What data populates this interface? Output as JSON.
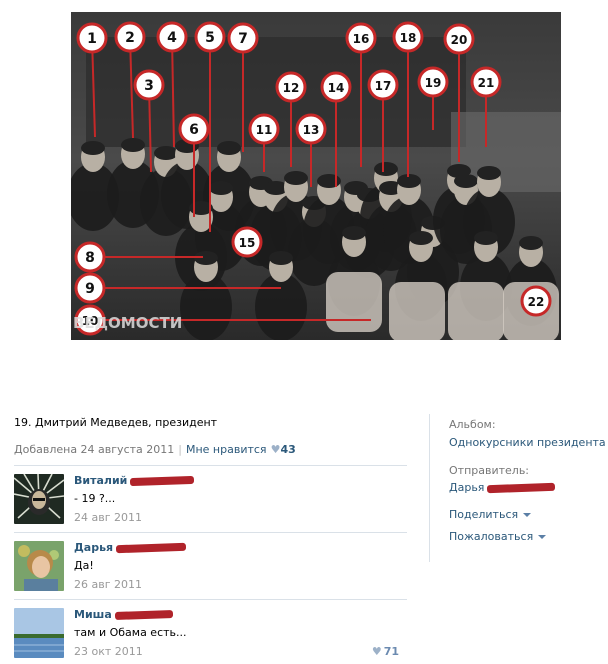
{
  "photo": {
    "numbers": [
      "1",
      "2",
      "3",
      "4",
      "5",
      "6",
      "7",
      "8",
      "9",
      "10",
      "11",
      "12",
      "13",
      "14",
      "15",
      "16",
      "17",
      "18",
      "19",
      "20",
      "21",
      "22"
    ],
    "watermark": "ВЕДОМОСТИ"
  },
  "caption": "19. Дмитрий Медведев, президент",
  "meta": {
    "added": "Добавлена 24 августа 2011",
    "separator": "|",
    "like_label": "Мне нравится",
    "heart": "♥",
    "like_count": "43"
  },
  "comments": [
    {
      "name": "Виталий",
      "text": "- 19 ?...",
      "date": "24 авг 2011",
      "likes": ""
    },
    {
      "name": "Дарья",
      "text": "Да!",
      "date": "26 авг 2011",
      "likes": ""
    },
    {
      "name": "Миша",
      "text": "там и Обама есть...",
      "date": "23 окт 2011",
      "likes": "71"
    }
  ],
  "sidebar": {
    "album_label": "Альбом:",
    "album_name": "Однокурсники президента",
    "sender_label": "Отправитель:",
    "sender_name": "Дарья",
    "share": "Поделиться",
    "report": "Пожаловаться"
  },
  "colors": {
    "link": "#2b587a",
    "muted": "#777777",
    "redact": "#b0232a",
    "marker": "#c62828"
  }
}
